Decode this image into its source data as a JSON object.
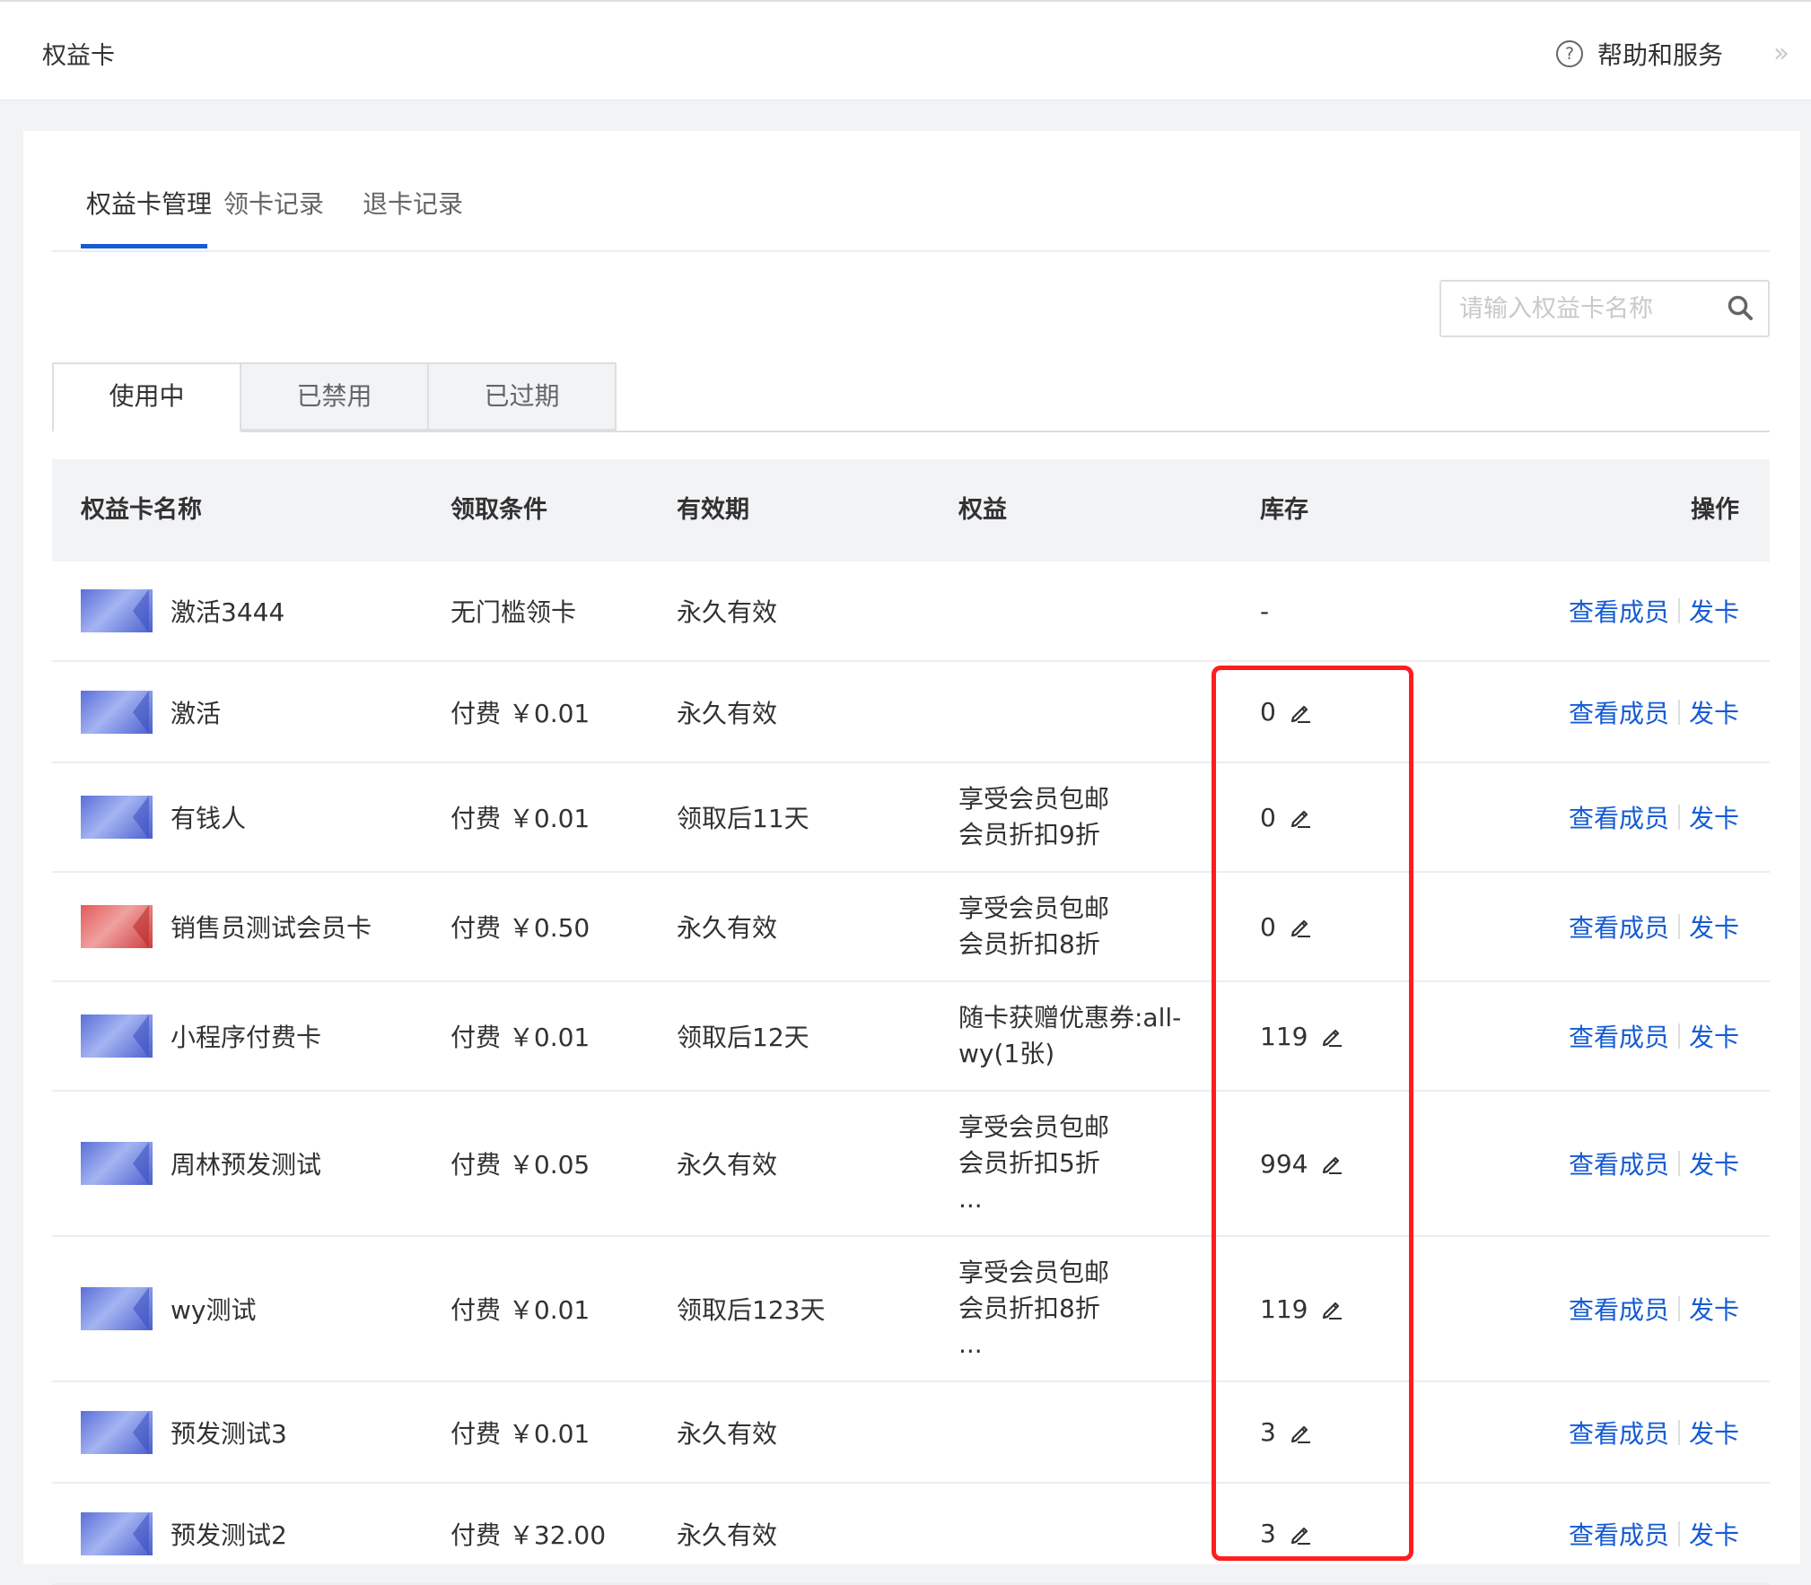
{
  "header": {
    "title": "权益卡",
    "help_label": "帮助和服务",
    "help_icon_glyph": "?"
  },
  "tabs": [
    {
      "label": "权益卡管理",
      "active": true
    },
    {
      "label": "领卡记录",
      "active": false
    },
    {
      "label": "退卡记录",
      "active": false
    }
  ],
  "search": {
    "placeholder": "请输入权益卡名称",
    "value": ""
  },
  "status_tabs": [
    {
      "label": "使用中",
      "active": true
    },
    {
      "label": "已禁用",
      "active": false
    },
    {
      "label": "已过期",
      "active": false
    }
  ],
  "table": {
    "columns": [
      "权益卡名称",
      "领取条件",
      "有效期",
      "权益",
      "库存",
      "操作"
    ],
    "rows": [
      {
        "name": "激活3444",
        "condition": "无门槛领卡",
        "validity": "永久有效",
        "benefits": [],
        "stock": "-",
        "editable": false,
        "card_color": "blue"
      },
      {
        "name": "激活",
        "condition": "付费 ￥0.01",
        "validity": "永久有效",
        "benefits": [],
        "stock": "0",
        "editable": true,
        "card_color": "blue"
      },
      {
        "name": "有钱人",
        "condition": "付费 ￥0.01",
        "validity": "领取后11天",
        "benefits": [
          "享受会员包邮",
          "会员折扣9折"
        ],
        "stock": "0",
        "editable": true,
        "card_color": "blue"
      },
      {
        "name": "销售员测试会员卡",
        "condition": "付费 ￥0.50",
        "validity": "永久有效",
        "benefits": [
          "享受会员包邮",
          "会员折扣8折"
        ],
        "stock": "0",
        "editable": true,
        "card_color": "red"
      },
      {
        "name": "小程序付费卡",
        "condition": "付费 ￥0.01",
        "validity": "领取后12天",
        "benefits": [
          "随卡获赠优惠券:all-",
          "wy(1张)"
        ],
        "stock": "119",
        "editable": true,
        "card_color": "blue"
      },
      {
        "name": "周林预发测试",
        "condition": "付费 ￥0.05",
        "validity": "永久有效",
        "benefits": [
          "享受会员包邮",
          "会员折扣5折",
          "..."
        ],
        "stock": "994",
        "editable": true,
        "card_color": "blue"
      },
      {
        "name": "wy测试",
        "condition": "付费 ￥0.01",
        "validity": "领取后123天",
        "benefits": [
          "享受会员包邮",
          "会员折扣8折",
          "..."
        ],
        "stock": "119",
        "editable": true,
        "card_color": "blue"
      },
      {
        "name": "预发测试3",
        "condition": "付费 ￥0.01",
        "validity": "永久有效",
        "benefits": [],
        "stock": "3",
        "editable": true,
        "card_color": "blue"
      },
      {
        "name": "预发测试2",
        "condition": "付费 ￥32.00",
        "validity": "永久有效",
        "benefits": [],
        "stock": "3",
        "editable": true,
        "card_color": "blue"
      }
    ],
    "actions": {
      "view_members": "查看成员",
      "issue_card": "发卡"
    }
  },
  "colors": {
    "link": "#155bd4",
    "highlight": "#ff1d1d",
    "tab_active": "#155bd4"
  }
}
